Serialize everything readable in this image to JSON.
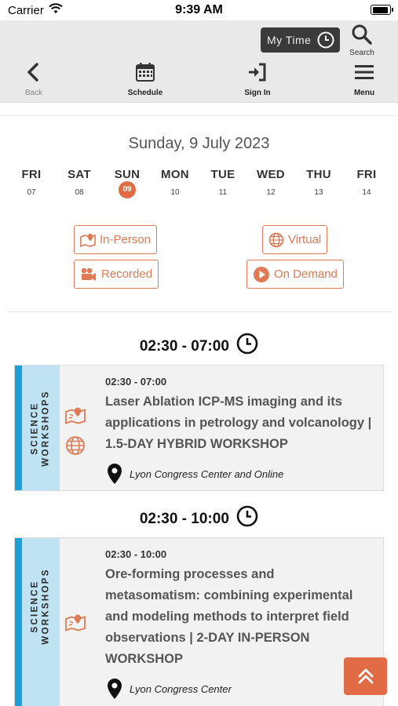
{
  "status_bar": {
    "carrier": "Carrier",
    "time": "9:39 AM"
  },
  "header": {
    "my_time_label": "My Time",
    "search_label": "Search",
    "nav": [
      {
        "label": "Back",
        "icon": "chevron-left-icon"
      },
      {
        "label": "Schedule",
        "icon": "calendar-icon"
      },
      {
        "label": "Sign In",
        "icon": "sign-in-icon"
      },
      {
        "label": "Menu",
        "icon": "hamburger-icon"
      }
    ]
  },
  "date_title": "Sunday, 9 July 2023",
  "days": [
    {
      "name": "FRI",
      "num": "07"
    },
    {
      "name": "SAT",
      "num": "08"
    },
    {
      "name": "SUN",
      "num": "09",
      "selected": true
    },
    {
      "name": "MON",
      "num": "10"
    },
    {
      "name": "TUE",
      "num": "11"
    },
    {
      "name": "WED",
      "num": "12"
    },
    {
      "name": "THU",
      "num": "13"
    },
    {
      "name": "FRI",
      "num": "14"
    }
  ],
  "filters": {
    "in_person": "In-Person",
    "virtual": "Virtual",
    "recorded": "Recorded",
    "on_demand": "On Demand"
  },
  "groups": [
    {
      "time": "02:30 - 07:00",
      "event": {
        "track": "SCIENCE WORKSHOPS",
        "time": "02:30 - 07:00",
        "title_lines": [
          "Laser Ablation ICP-MS imaging and its",
          "applications in petrology and volcanology |",
          "1.5-DAY HYBRID WORKSHOP"
        ],
        "location": "Lyon Congress Center and Online"
      }
    },
    {
      "time": "02:30 - 10:00",
      "event": {
        "track": "SCIENCE WORKSHOPS",
        "time": "02:30 - 10:00",
        "title_lines": [
          "Ore-forming processes and",
          "metasomatism: combining experimental",
          "and modeling methods to interpret field",
          "observations | 2-DAY IN-PERSON",
          "WORKSHOP"
        ],
        "location": "Lyon Congress Center"
      }
    }
  ],
  "colors": {
    "accent": "#e06b45",
    "track_dark": "#1a9fd6",
    "track_light": "#bfe3f3",
    "header_bg": "#e9e9e9"
  }
}
